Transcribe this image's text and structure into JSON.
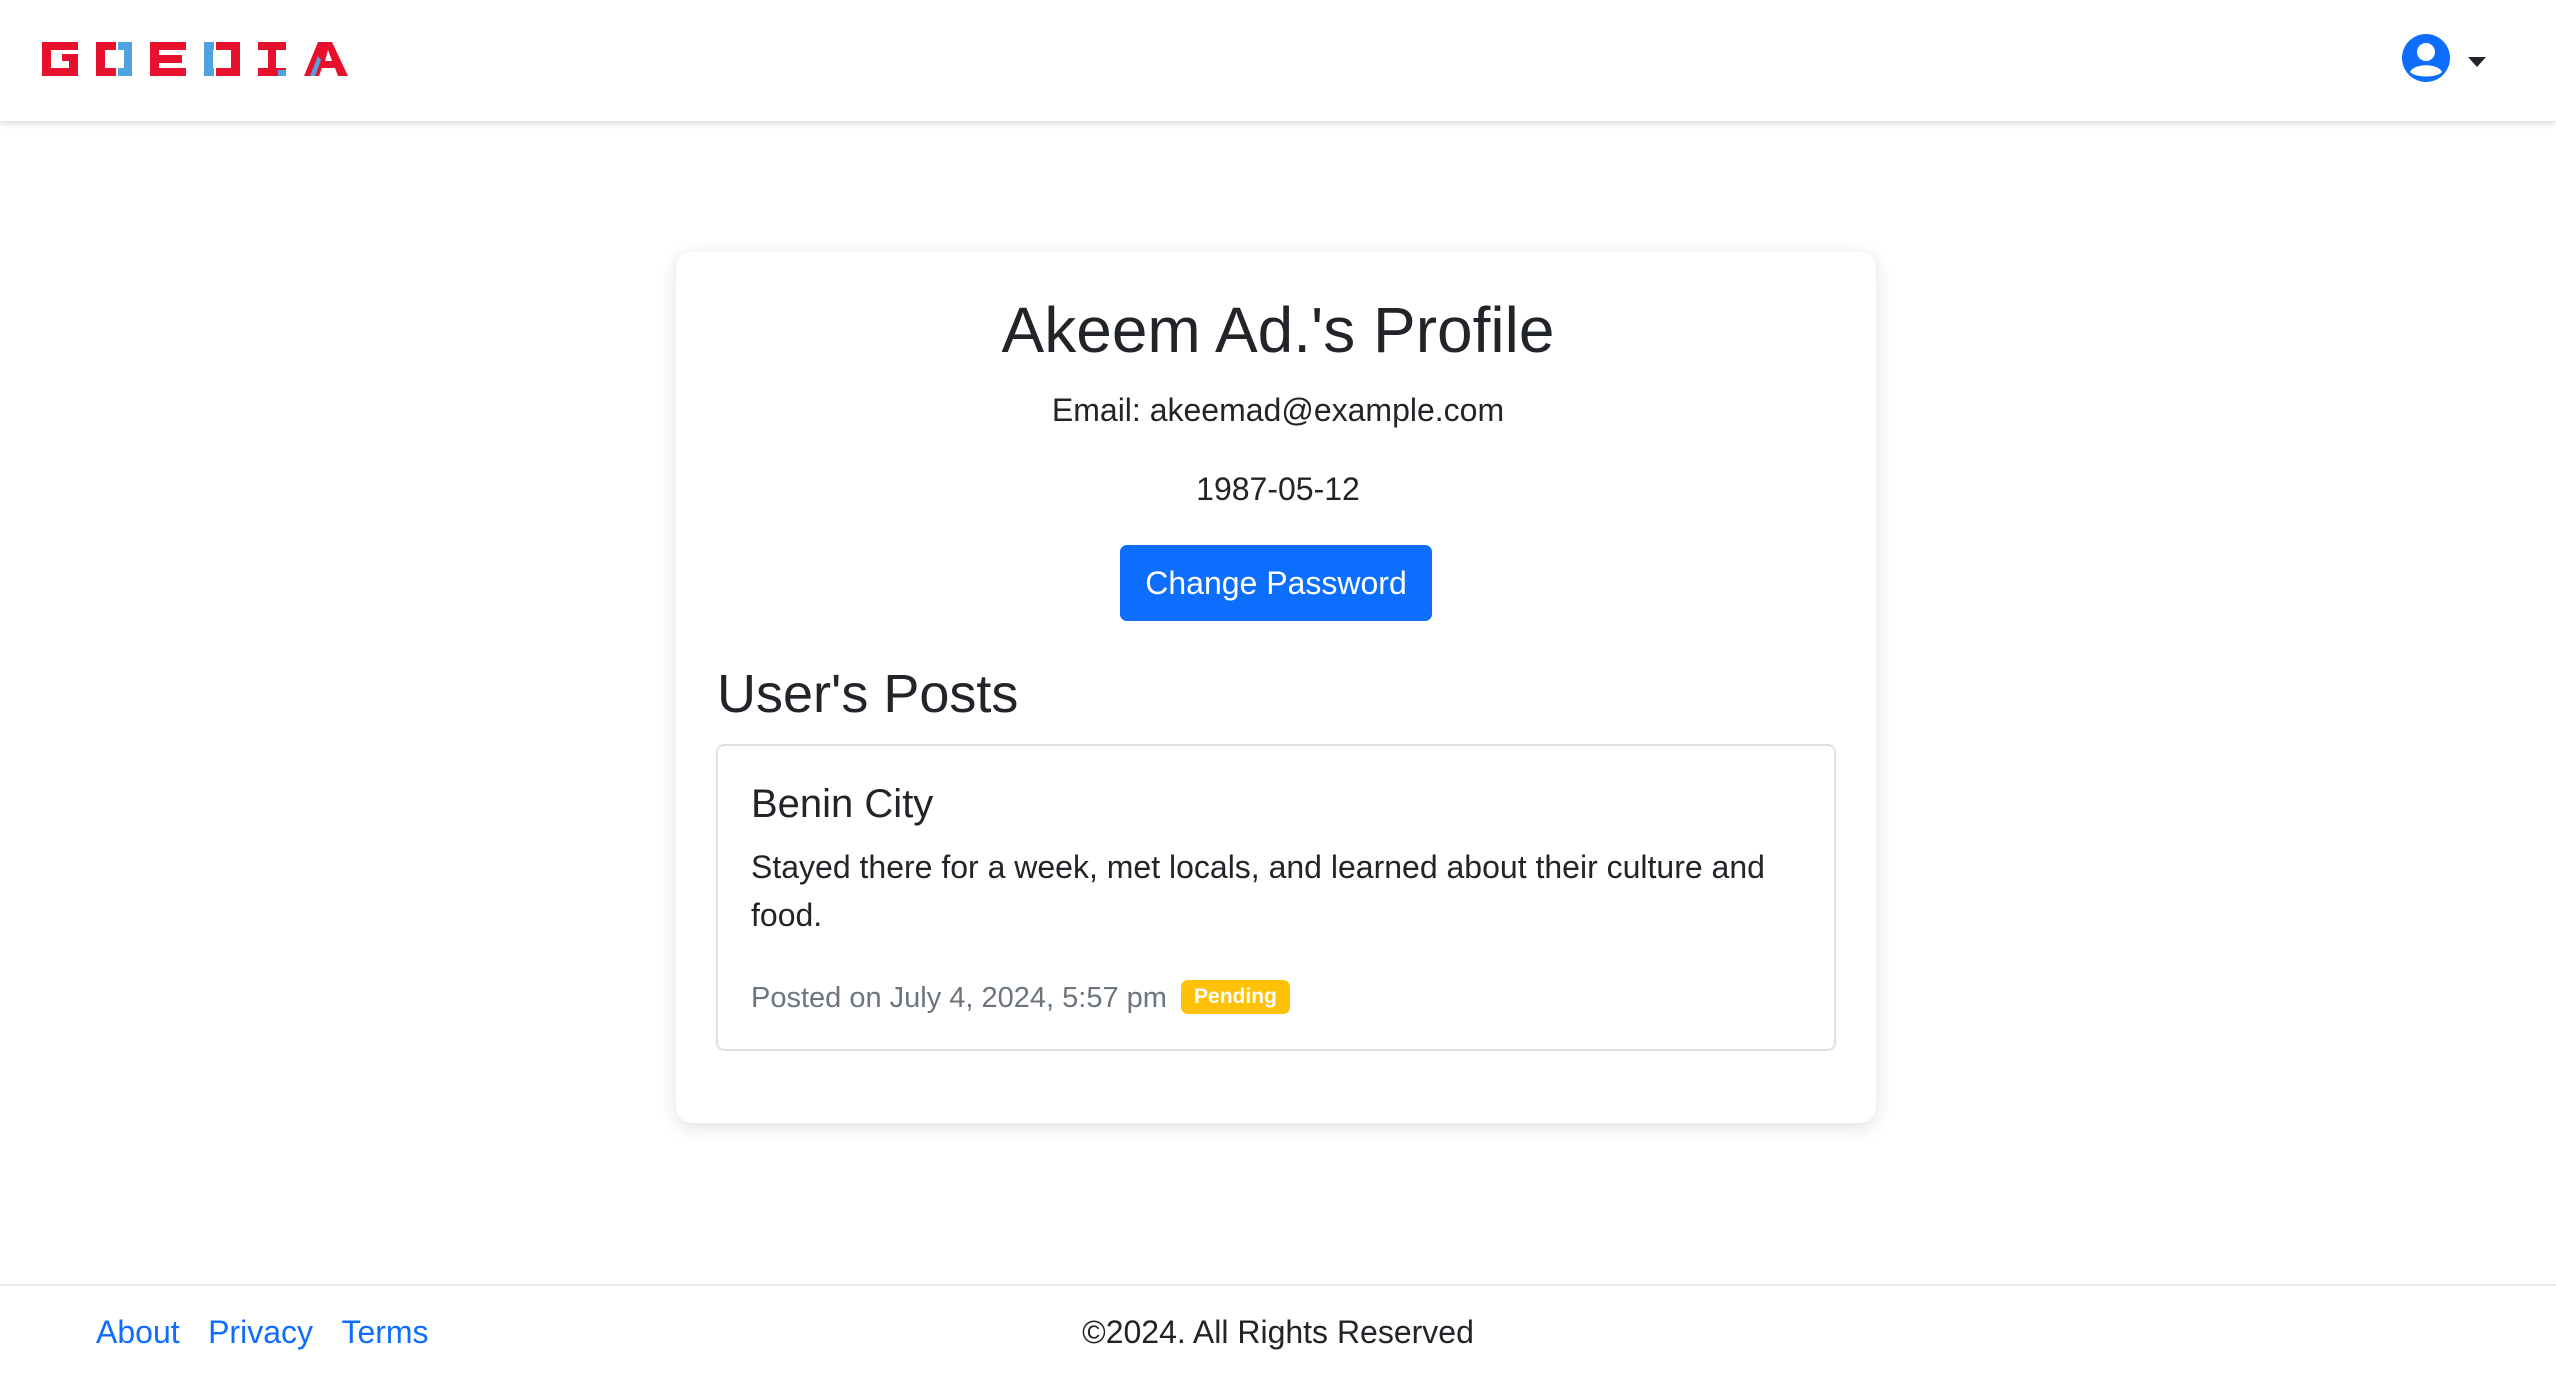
{
  "header": {
    "logo_text": "GOEDIA",
    "user_menu_icon": "user-circle-icon",
    "dropdown_icon": "caret-down-icon"
  },
  "profile": {
    "title": "Akeem Ad.'s Profile",
    "email_line": "Email: akeemad@example.com",
    "dob": "1987-05-12",
    "change_password_label": "Change Password"
  },
  "posts": {
    "heading": "User's Posts",
    "items": [
      {
        "title": "Benin City",
        "body": "Stayed there for a week, met locals, and learned about their culture and food.",
        "meta": "Posted on July 4, 2024, 5:57 pm",
        "status": "Pending"
      }
    ]
  },
  "footer": {
    "links": [
      "About",
      "Privacy",
      "Terms"
    ],
    "copyright": "©2024. All Rights Reserved"
  },
  "colors": {
    "primary": "#0d6efd",
    "logo_red": "#e8112d",
    "logo_blue": "#4fa3e0",
    "badge_warning": "#ffc107",
    "muted_text": "#6c757d"
  }
}
